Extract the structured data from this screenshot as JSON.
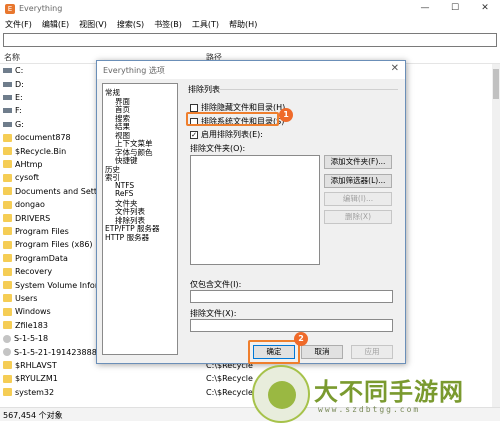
{
  "window": {
    "title": "Everything",
    "icon_letter": "E"
  },
  "menu": [
    "文件(F)",
    "编辑(E)",
    "视图(V)",
    "搜索(S)",
    "书签(B)",
    "工具(T)",
    "帮助(H)"
  ],
  "search": {
    "value": ""
  },
  "columns": {
    "name": "名称",
    "path": "路径"
  },
  "rows": [
    {
      "name": "C:",
      "type": "drive",
      "path": ""
    },
    {
      "name": "D:",
      "type": "drive",
      "path": ""
    },
    {
      "name": "E:",
      "type": "drive",
      "path": ""
    },
    {
      "name": "F:",
      "type": "drive",
      "path": ""
    },
    {
      "name": "G:",
      "type": "drive",
      "path": ""
    },
    {
      "name": "document878",
      "type": "folder",
      "path": ""
    },
    {
      "name": "$Recycle.Bin",
      "type": "folder",
      "path": ""
    },
    {
      "name": "AHtmp",
      "type": "folder",
      "path": ""
    },
    {
      "name": "cysoft",
      "type": "folder",
      "path": ""
    },
    {
      "name": "Documents and Settin",
      "type": "folder",
      "path": ""
    },
    {
      "name": "dongao",
      "type": "folder",
      "path": ""
    },
    {
      "name": "DRIVERS",
      "type": "folder",
      "path": ""
    },
    {
      "name": "Program Files",
      "type": "folder",
      "path": ""
    },
    {
      "name": "Program Files (x86)",
      "type": "folder",
      "path": ""
    },
    {
      "name": "ProgramData",
      "type": "folder",
      "path": ""
    },
    {
      "name": "Recovery",
      "type": "folder",
      "path": ""
    },
    {
      "name": "System Volume Inforn",
      "type": "folder",
      "path": ""
    },
    {
      "name": "Users",
      "type": "folder",
      "path": ""
    },
    {
      "name": "Windows",
      "type": "folder",
      "path": ""
    },
    {
      "name": "Zfile183",
      "type": "folder",
      "path": ""
    },
    {
      "name": "S-1-5-18",
      "type": "user",
      "path": ""
    },
    {
      "name": "S-1-5-21-1914238884",
      "type": "user",
      "path": ""
    },
    {
      "name": "$RHLAVST",
      "type": "folder",
      "path": "C:\\$Recycle"
    },
    {
      "name": "$RYULZM1",
      "type": "folder",
      "path": "C:\\$Recycle"
    },
    {
      "name": "system32",
      "type": "folder",
      "path": "C:\\$Recycle"
    }
  ],
  "status": "567,454 个对象",
  "dialog": {
    "title": "Everything 选项",
    "close_glyph": "✕",
    "tree": [
      {
        "label": "常规",
        "indent": 0
      },
      {
        "label": "界面",
        "indent": 1
      },
      {
        "label": "首页",
        "indent": 1
      },
      {
        "label": "搜索",
        "indent": 1
      },
      {
        "label": "结果",
        "indent": 1
      },
      {
        "label": "视图",
        "indent": 1
      },
      {
        "label": "上下文菜单",
        "indent": 1
      },
      {
        "label": "字体与颜色",
        "indent": 1
      },
      {
        "label": "快捷键",
        "indent": 1
      },
      {
        "label": "历史",
        "indent": 0
      },
      {
        "label": "索引",
        "indent": 0
      },
      {
        "label": "NTFS",
        "indent": 1
      },
      {
        "label": "ReFS",
        "indent": 1
      },
      {
        "label": "文件夹",
        "indent": 1
      },
      {
        "label": "文件列表",
        "indent": 1
      },
      {
        "label": "排除列表",
        "indent": 1
      },
      {
        "label": "ETP/FTP 服务器",
        "indent": 0
      },
      {
        "label": "HTTP 服务器",
        "indent": 0
      }
    ],
    "section": "排除列表",
    "checkboxes": [
      {
        "label": "排除隐藏文件和目录(H)",
        "checked": false,
        "mark": ""
      },
      {
        "label": "排除系统文件和目录(S)",
        "checked": false,
        "mark": ""
      },
      {
        "label": "启用排除列表(E):",
        "checked": true,
        "mark": "✓"
      }
    ],
    "exclude_folders_label": "排除文件夹(O):",
    "buttons_side": [
      {
        "label": "添加文件夹(F)...",
        "disabled": false
      },
      {
        "label": "添加筛选器(L)...",
        "disabled": false
      },
      {
        "label": "编辑(I)...",
        "disabled": true
      },
      {
        "label": "删除(X)",
        "disabled": true
      }
    ],
    "include_only_label": "仅包含文件(I):",
    "exclude_files_label": "排除文件(X):",
    "ok": "确定",
    "cancel": "取消",
    "apply": "应用",
    "badge1": "1",
    "badge2": "2"
  },
  "watermark": {
    "text": "大不同手游网",
    "url": "www.szdbtgg.com"
  }
}
